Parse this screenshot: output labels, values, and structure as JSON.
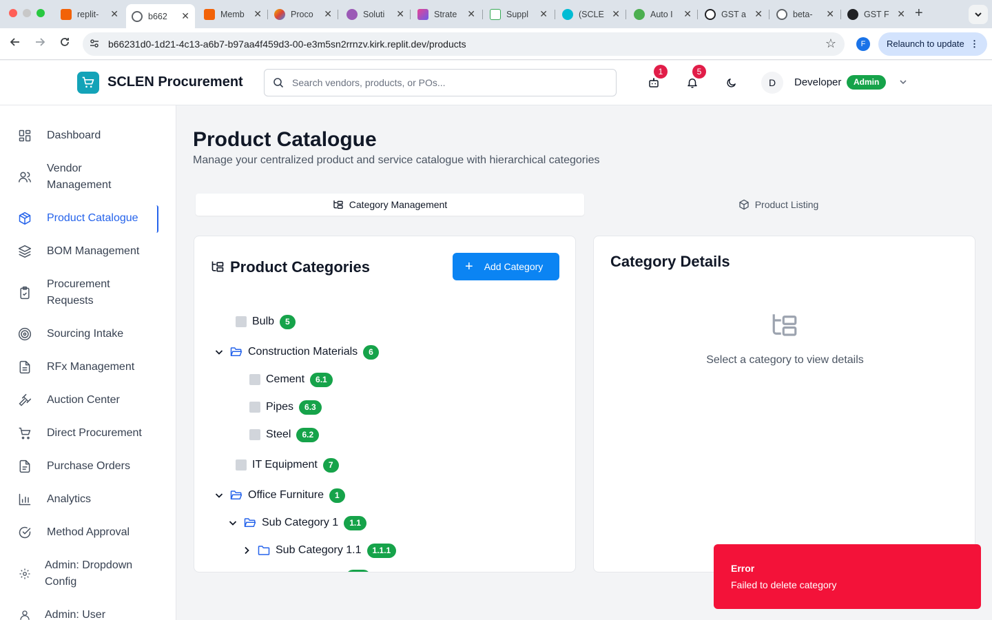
{
  "browser": {
    "tabs": [
      {
        "title": "replit-",
        "fav_color": "#f26207"
      },
      {
        "title": "b662",
        "fav_color": "#5f6368"
      },
      {
        "title": "Memb",
        "fav_color": "#f26207"
      },
      {
        "title": "Proco",
        "fav_color": "#8e44ad"
      },
      {
        "title": "Soluti",
        "fav_color": "#9b59b6"
      },
      {
        "title": "Strate",
        "fav_color": "#e84393"
      },
      {
        "title": "Suppl",
        "fav_color": "#34a853"
      },
      {
        "title": "(SCLE",
        "fav_color": "#00bcd4"
      },
      {
        "title": "Auto I",
        "fav_color": "#4caf50"
      },
      {
        "title": "GST a",
        "fav_color": "#202124"
      },
      {
        "title": "beta-",
        "fav_color": "#5f6368"
      },
      {
        "title": "GST F",
        "fav_color": "#202124"
      }
    ],
    "url": "b66231d0-1d21-4c13-a6b7-b97aa4f459d3-00-e3m5sn2rrnzv.kirk.replit.dev/products",
    "profile_initial": "F",
    "relaunch_label": "Relaunch to update"
  },
  "header": {
    "brand": "SCLEN Procurement",
    "search_placeholder": "Search vendors, products, or POs...",
    "cart_badge": "1",
    "bell_badge": "5",
    "avatar_initial": "D",
    "user_name": "Developer",
    "role": "Admin"
  },
  "sidebar": {
    "items": [
      {
        "label": "Dashboard",
        "icon": "dashboard-icon"
      },
      {
        "label": "Vendor Management",
        "icon": "users-icon"
      },
      {
        "label": "Product Catalogue",
        "icon": "box-icon"
      },
      {
        "label": "BOM Management",
        "icon": "layers-icon"
      },
      {
        "label": "Procurement Requests",
        "icon": "clipboard-check-icon"
      },
      {
        "label": "Sourcing Intake",
        "icon": "target-icon"
      },
      {
        "label": "RFx Management",
        "icon": "document-icon"
      },
      {
        "label": "Auction Center",
        "icon": "gavel-icon"
      },
      {
        "label": "Direct Procurement",
        "icon": "cart-icon"
      },
      {
        "label": "Purchase Orders",
        "icon": "file-text-icon"
      },
      {
        "label": "Analytics",
        "icon": "bar-chart-icon"
      },
      {
        "label": "Method Approval",
        "icon": "check-circle-icon"
      },
      {
        "label": "Admin: Dropdown Config",
        "icon": "settings-icon"
      },
      {
        "label": "Admin: User",
        "icon": "user-admin-icon"
      }
    ]
  },
  "main": {
    "title": "Product Catalogue",
    "subtitle": "Manage your centralized product and service catalogue with hierarchical categories",
    "tabs": [
      {
        "label": "Category Management"
      },
      {
        "label": "Product Listing"
      }
    ],
    "categories_title": "Product Categories",
    "add_category_label": "Add Category",
    "tree": [
      {
        "name": "Bulb",
        "code": "5"
      },
      {
        "name": "Construction Materials",
        "code": "6"
      },
      {
        "name": "Cement",
        "code": "6.1"
      },
      {
        "name": "Pipes",
        "code": "6.3"
      },
      {
        "name": "Steel",
        "code": "6.2"
      },
      {
        "name": "IT Equipment",
        "code": "7"
      },
      {
        "name": "Office Furniture",
        "code": "1"
      },
      {
        "name": "Sub Category 1",
        "code": "1.1"
      },
      {
        "name": "Sub Category 1.1",
        "code": "1.1.1"
      }
    ],
    "details_title": "Category Details",
    "details_empty": "Select a category to view details"
  },
  "toast": {
    "title": "Error",
    "message": "Failed to delete category"
  },
  "colors": {
    "accent": "#2563eb",
    "success": "#16a34a",
    "error": "#f31239",
    "primary_button": "#0b84f3"
  }
}
